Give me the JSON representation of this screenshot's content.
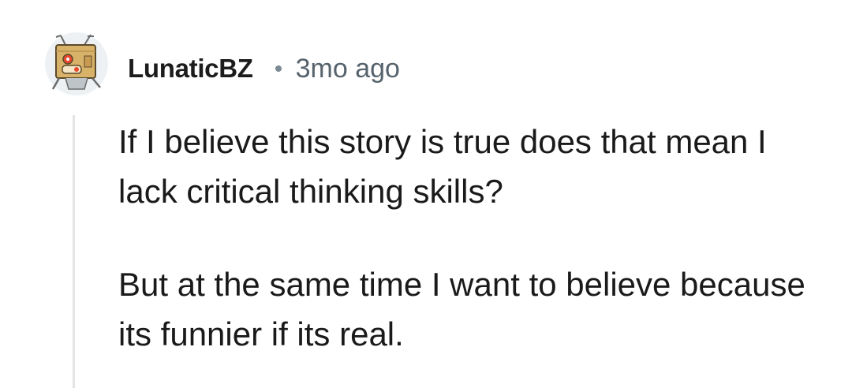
{
  "comment": {
    "author": "LunaticBZ",
    "separator": "•",
    "timestamp": "3mo ago",
    "avatar_icon": "robot-snoo-avatar-icon",
    "paragraphs": [
      "If I believe this story is true does that mean I lack critical thinking skills?",
      "But at the same time I want to believe because its funnier if its real."
    ]
  },
  "colors": {
    "username": "#1c1c1c",
    "timestamp": "#56636c",
    "body_text": "#1a1a1b",
    "thread_line": "#e2e4e6",
    "avatar_box": "#d9b26a"
  }
}
